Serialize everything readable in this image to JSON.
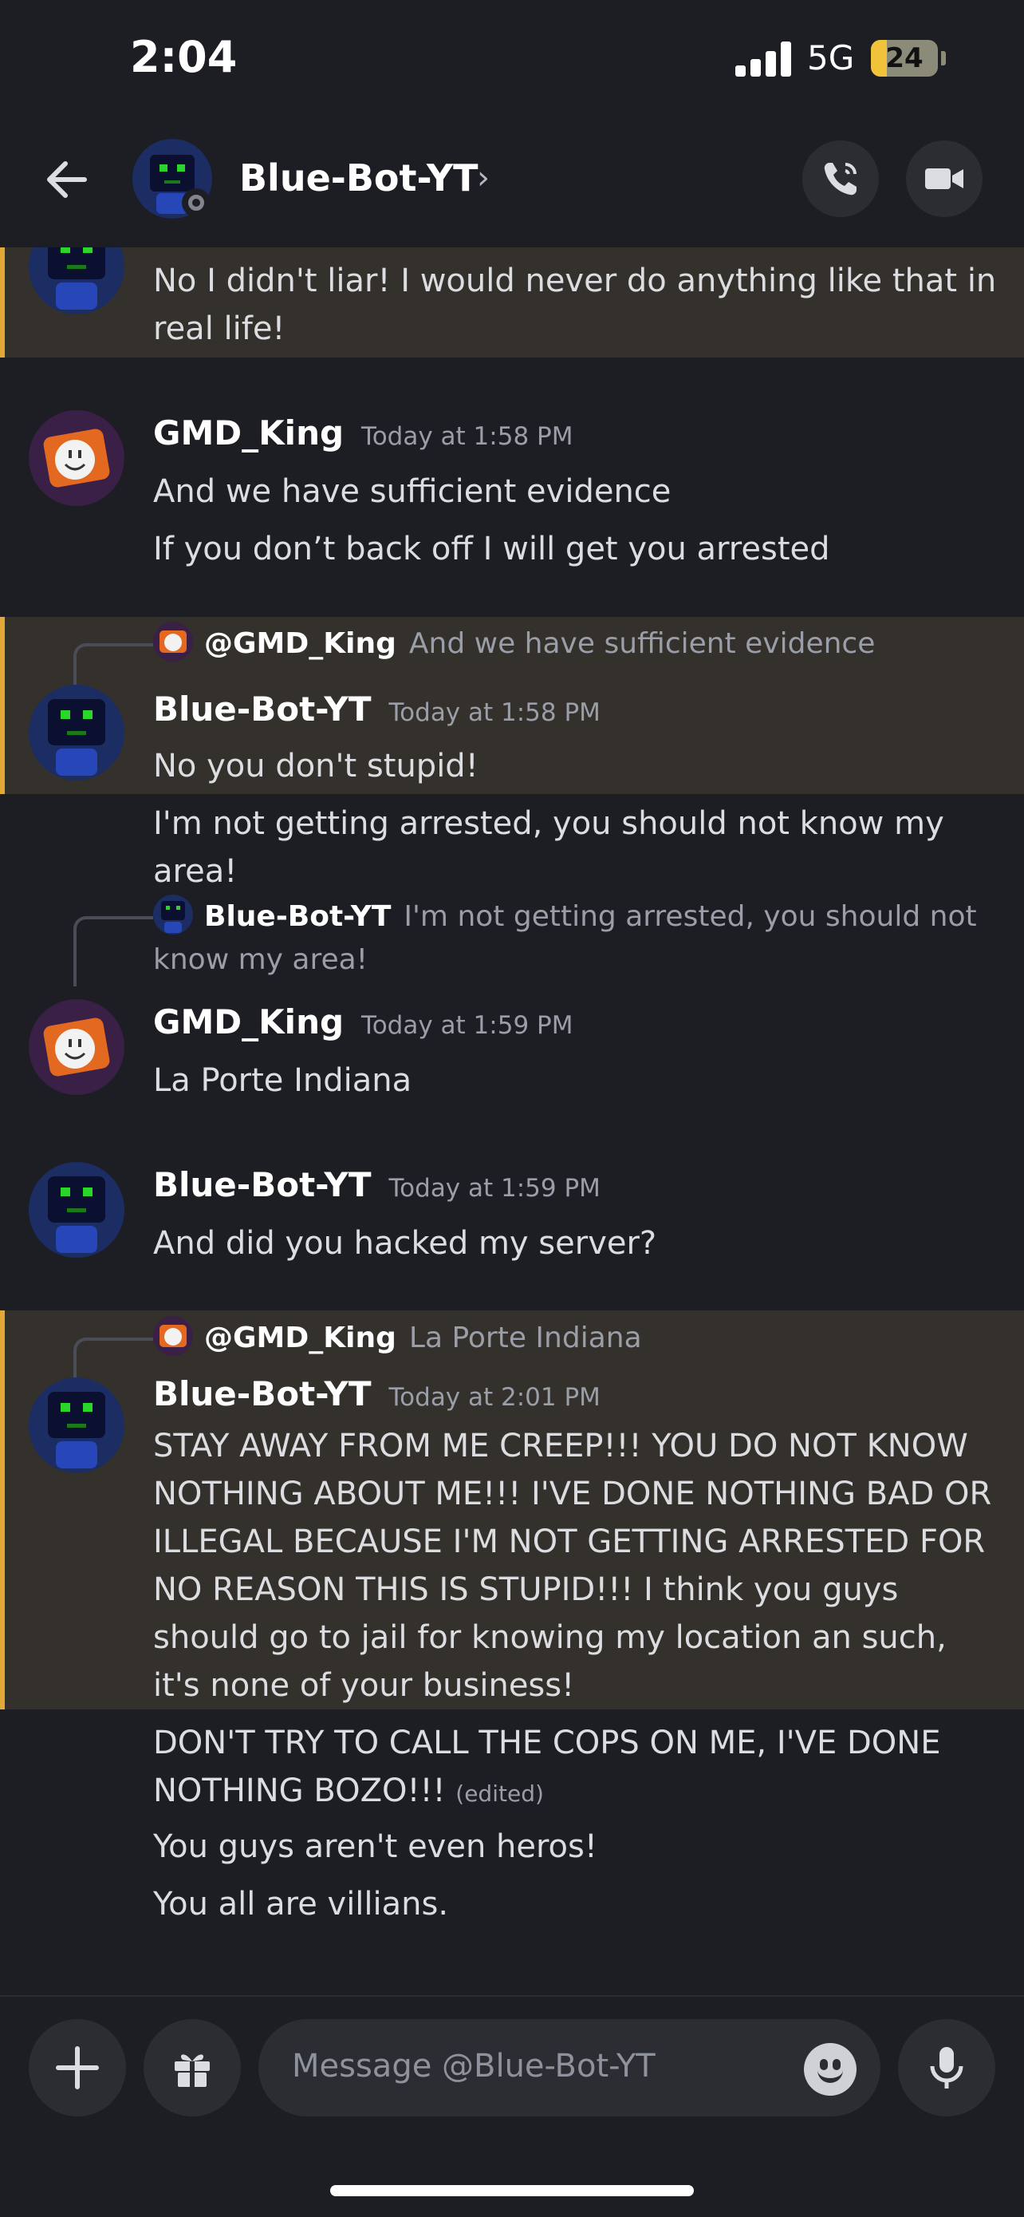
{
  "status_bar": {
    "time": "2:04",
    "network": "5G",
    "battery": "24"
  },
  "header": {
    "title": "Blue-Bot-YT",
    "chevron": "›",
    "icons": [
      "back-arrow-icon",
      "call-icon",
      "video-icon"
    ]
  },
  "messages": {
    "m0": {
      "text": "No I didn't liar! I would never do anything like that in real life!"
    },
    "m1": {
      "author": "GMD_King",
      "timestamp": "Today at 1:58 PM",
      "line1": "And we have sufficient evidence",
      "line2": "If you don’t back off I will get you arrested"
    },
    "m2": {
      "reply_name": "@GMD_King",
      "reply_text": "And we have sufficient evidence",
      "author": "Blue-Bot-YT",
      "timestamp": "Today at 1:58 PM",
      "line1": "No you don't stupid!",
      "line2": "I'm not getting arrested, you should not know my area!"
    },
    "m3": {
      "reply_name": "Blue-Bot-YT",
      "reply_text": "I'm not getting arrested, you should not know my area!",
      "author": "GMD_King",
      "timestamp": "Today at 1:59 PM",
      "line1": "La Porte Indiana"
    },
    "m4": {
      "author": "Blue-Bot-YT",
      "timestamp": "Today at 1:59 PM",
      "line1": "And did you hacked my server?"
    },
    "m5": {
      "reply_name": "@GMD_King",
      "reply_text": "La Porte Indiana",
      "author": "Blue-Bot-YT",
      "timestamp": "Today at 2:01 PM",
      "line1": "STAY AWAY FROM ME CREEP!!! YOU DO NOT KNOW NOTHING ABOUT ME!!! I'VE DONE NOTHING BAD OR ILLEGAL BECAUSE I'M NOT GETTING ARRESTED FOR NO REASON THIS IS STUPID!!! I think you guys should go to jail for knowing my location an such, it's none of your business!",
      "line2": "DON'T TRY TO CALL THE COPS ON ME, I'VE DONE NOTHING BOZO!!!",
      "edited": "(edited)",
      "line3": "You guys aren't even heros!",
      "line4": "You all are villians."
    }
  },
  "composer": {
    "placeholder": "Message @Blue-Bot-YT",
    "icons": [
      "plus-icon",
      "gift-icon",
      "emoji-icon",
      "microphone-icon"
    ]
  },
  "colors": {
    "background": "#1d1e23",
    "highlight": "#34302b",
    "highlight_bar": "#e3a936",
    "bot_blue": "#1b2d63",
    "bot_face": "#2bd62b"
  }
}
